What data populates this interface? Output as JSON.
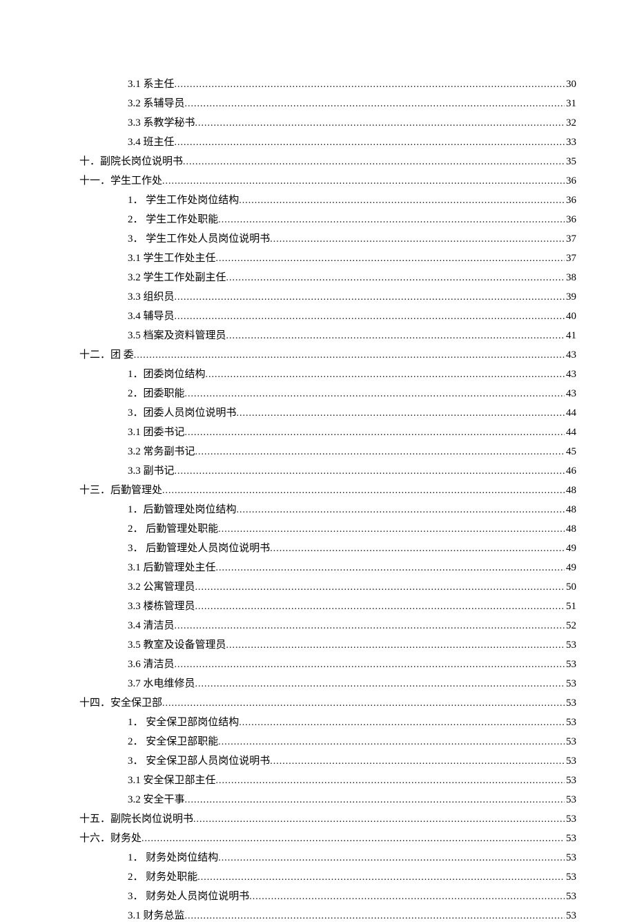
{
  "toc": [
    {
      "indent": 2,
      "label": "3.1  系主任",
      "page": "30"
    },
    {
      "indent": 2,
      "label": "3.2  系辅导员",
      "page": "31"
    },
    {
      "indent": 2,
      "label": "3.3  系教学秘书",
      "page": "32"
    },
    {
      "indent": 2,
      "label": "3.4  班主任",
      "page": "33"
    },
    {
      "indent": 1,
      "label": "十．副院长岗位说明书",
      "page": "35"
    },
    {
      "indent": 1,
      "label": "十一．学生工作处",
      "page": "36"
    },
    {
      "indent": 2,
      "label": "1． 学生工作处岗位结构",
      "page": "36"
    },
    {
      "indent": 2,
      "label": "2． 学生工作处职能",
      "page": "36"
    },
    {
      "indent": 2,
      "label": "3． 学生工作处人员岗位说明书",
      "page": "37"
    },
    {
      "indent": 2,
      "label": "3.1  学生工作处主任",
      "page": "37"
    },
    {
      "indent": 2,
      "label": "3.2  学生工作处副主任",
      "page": "38"
    },
    {
      "indent": 2,
      "label": "3.3  组织员",
      "page": "39"
    },
    {
      "indent": 2,
      "label": "3.4  辅导员",
      "page": "40"
    },
    {
      "indent": 2,
      "label": "3.5  档案及资料管理员",
      "page": "41"
    },
    {
      "indent": 1,
      "label": "十二．团    委",
      "page": "43"
    },
    {
      "indent": 2,
      "label": "1．团委岗位结构",
      "page": "43"
    },
    {
      "indent": 2,
      "label": "2．团委职能",
      "page": "43"
    },
    {
      "indent": 2,
      "label": "3．团委人员岗位说明书",
      "page": "44"
    },
    {
      "indent": 2,
      "label": "3.1  团委书记",
      "page": "44"
    },
    {
      "indent": 2,
      "label": "3.2  常务副书记",
      "page": "45"
    },
    {
      "indent": 2,
      "label": "3.3  副书记",
      "page": "46"
    },
    {
      "indent": 1,
      "label": "十三．后勤管理处",
      "page": "48"
    },
    {
      "indent": 2,
      "label": "1．后勤管理处岗位结构",
      "page": "48"
    },
    {
      "indent": 2,
      "label": "2． 后勤管理处职能",
      "page": "48"
    },
    {
      "indent": 2,
      "label": "3． 后勤管理处人员岗位说明书",
      "page": "49"
    },
    {
      "indent": 2,
      "label": "3.1  后勤管理处主任",
      "page": "49"
    },
    {
      "indent": 2,
      "label": "3.2  公寓管理员",
      "page": "50"
    },
    {
      "indent": 2,
      "label": "3.3  楼栋管理员",
      "page": "51"
    },
    {
      "indent": 2,
      "label": "3.4  清洁员",
      "page": "52"
    },
    {
      "indent": 2,
      "label": "3.5  教室及设备管理员",
      "page": "53"
    },
    {
      "indent": 2,
      "label": "3.6  清洁员",
      "page": "53"
    },
    {
      "indent": 2,
      "label": "3.7  水电维修员",
      "page": "53"
    },
    {
      "indent": 1,
      "label": "十四．安全保卫部",
      "page": "53"
    },
    {
      "indent": 2,
      "label": "1． 安全保卫部岗位结构",
      "page": "53"
    },
    {
      "indent": 2,
      "label": "2． 安全保卫部职能",
      "page": "53"
    },
    {
      "indent": 2,
      "label": "3． 安全保卫部人员岗位说明书",
      "page": "53"
    },
    {
      "indent": 2,
      "label": "3.1  安全保卫部主任",
      "page": "53"
    },
    {
      "indent": 2,
      "label": "3.2  安全干事",
      "page": "53"
    },
    {
      "indent": 1,
      "label": "十五．副院长岗位说明书",
      "page": "53"
    },
    {
      "indent": 1,
      "label": "十六．财务处",
      "page": "53"
    },
    {
      "indent": 2,
      "label": "1． 财务处岗位结构",
      "page": "53"
    },
    {
      "indent": 2,
      "label": "2． 财务处职能",
      "page": "53"
    },
    {
      "indent": 2,
      "label": "3． 财务处人员岗位说明书",
      "page": "53"
    },
    {
      "indent": 2,
      "label": "3.1  财务总监",
      "page": "53"
    }
  ]
}
